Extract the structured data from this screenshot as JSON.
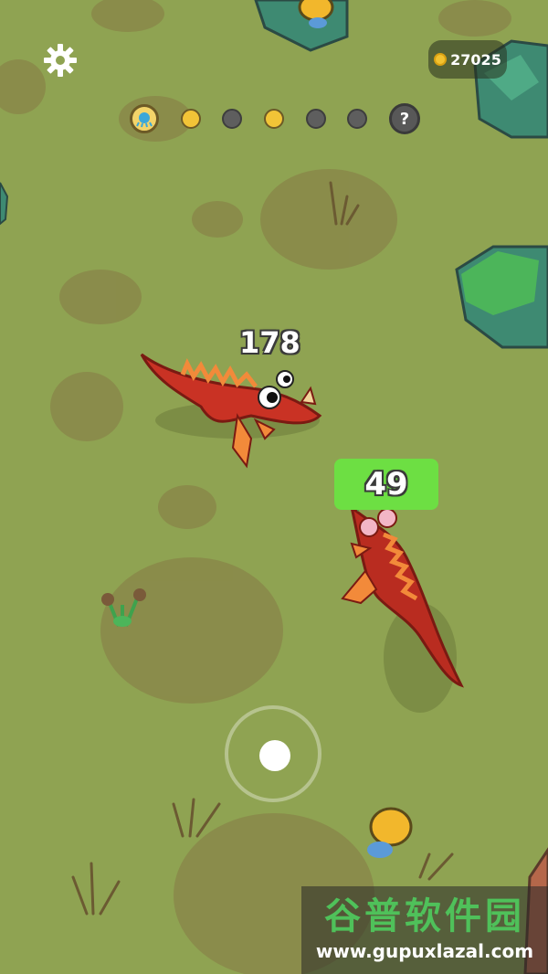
{
  "hud": {
    "coins": "27025",
    "settings_icon": "gear-icon",
    "coin_icon": "coin-icon"
  },
  "evolution": {
    "stages": [
      {
        "state": "current",
        "icon": "blue-creature-icon"
      },
      {
        "state": "unlocked"
      },
      {
        "state": "locked"
      },
      {
        "state": "unlocked"
      },
      {
        "state": "locked"
      },
      {
        "state": "locked"
      }
    ],
    "unknown_label": "?"
  },
  "creatures": {
    "enemy": {
      "level": "178",
      "color": "#c93224"
    },
    "player": {
      "level": "49",
      "color": "#b92c20",
      "highlight": "#6ddf43"
    }
  },
  "joystick": {
    "icon": "joystick-icon"
  },
  "watermark": {
    "brand": "谷普软件园",
    "url": "www.gupuxlazal.com"
  }
}
